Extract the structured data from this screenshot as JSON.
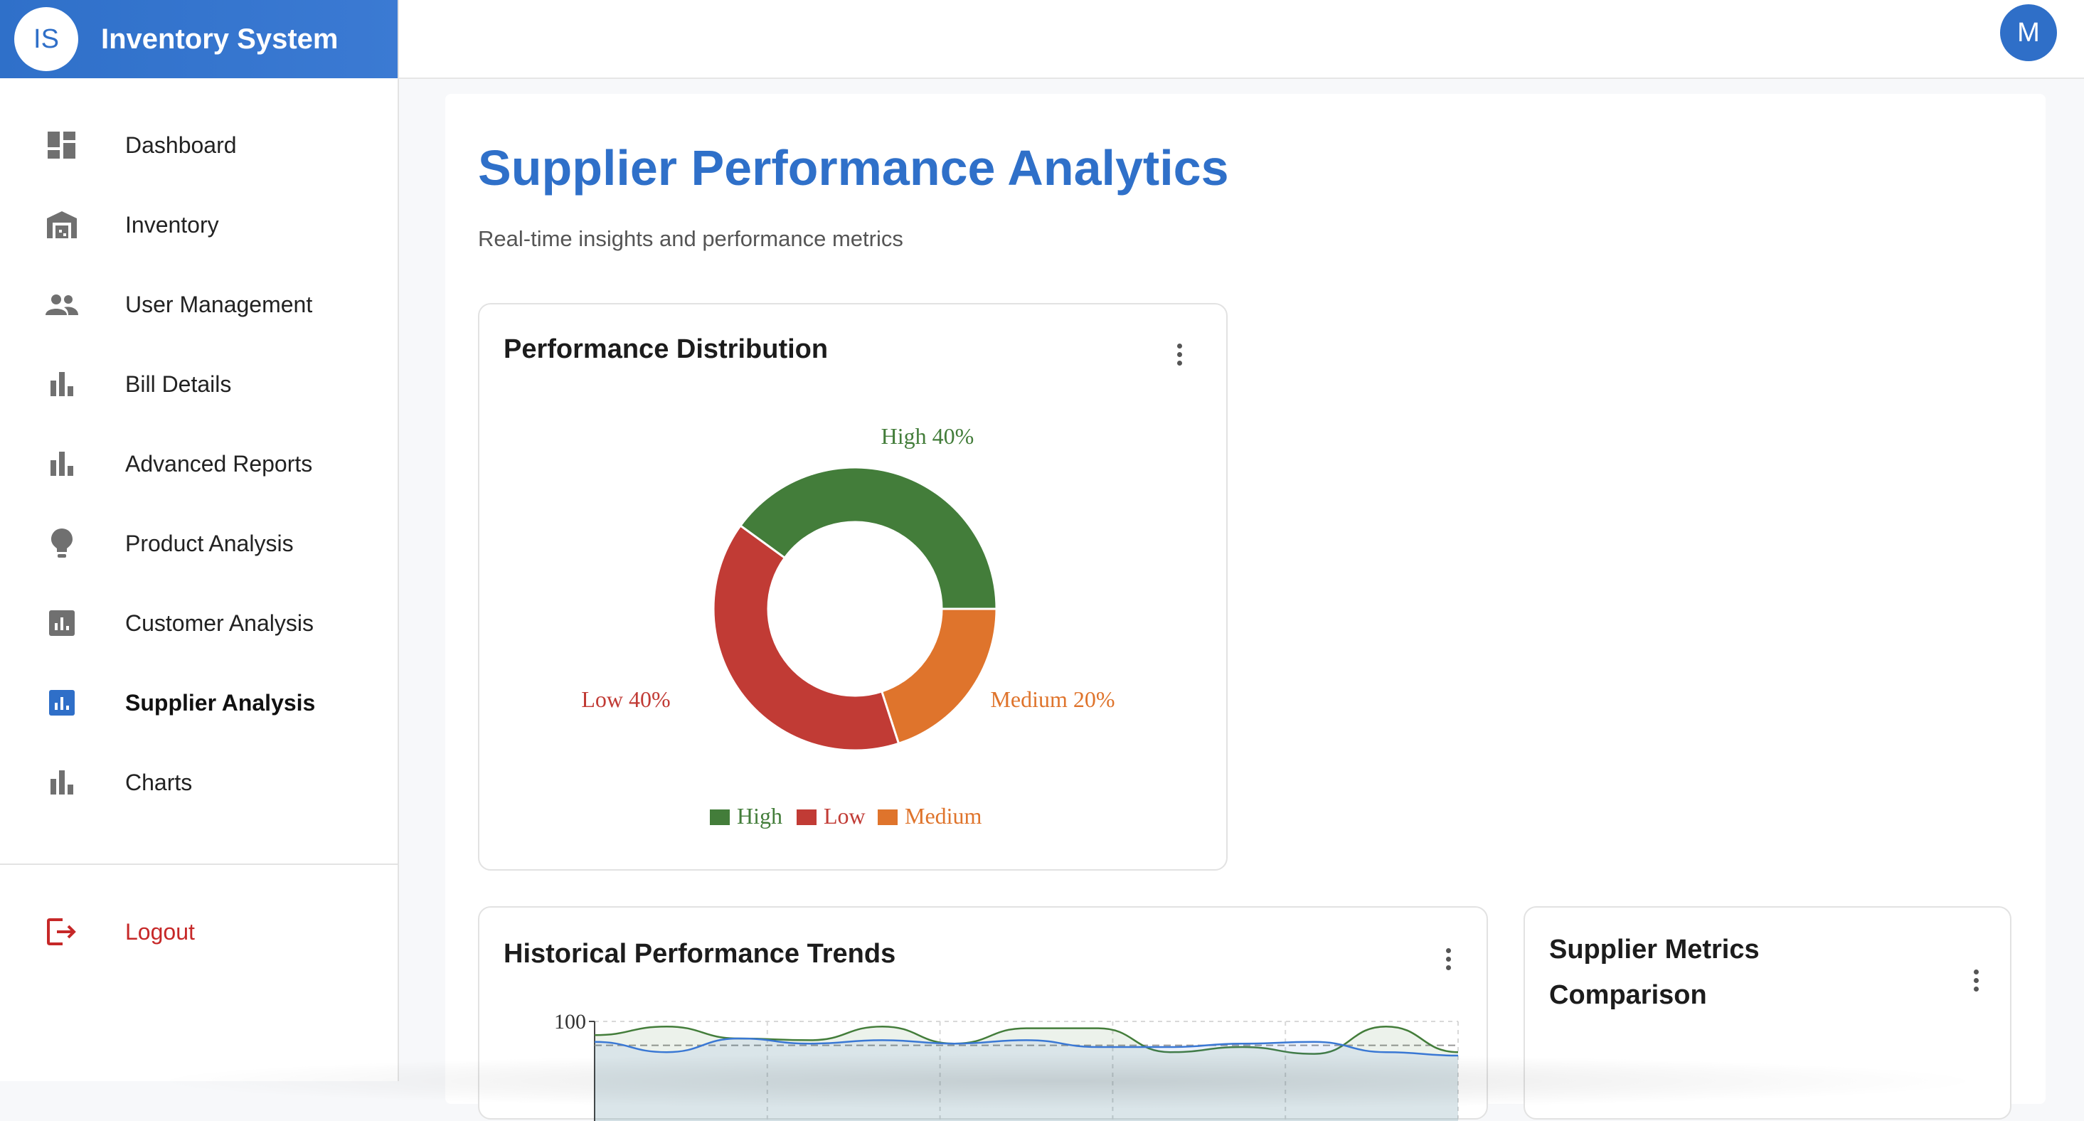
{
  "app": {
    "logo_text": "IS",
    "title": "Inventory System",
    "user_initial": "M"
  },
  "sidebar": {
    "items": [
      {
        "label": "Dashboard",
        "icon": "dashboard-icon"
      },
      {
        "label": "Inventory",
        "icon": "warehouse-icon"
      },
      {
        "label": "User Management",
        "icon": "people-icon"
      },
      {
        "label": "Bill Details",
        "icon": "bar-chart-icon"
      },
      {
        "label": "Advanced Reports",
        "icon": "bar-chart-icon"
      },
      {
        "label": "Product Analysis",
        "icon": "lightbulb-icon"
      },
      {
        "label": "Customer Analysis",
        "icon": "analytics-box-icon"
      },
      {
        "label": "Supplier Analysis",
        "icon": "analytics-box-icon",
        "active": true
      },
      {
        "label": "Charts",
        "icon": "bar-chart-icon"
      }
    ],
    "logout_label": "Logout",
    "active_color": "#2f6fc8",
    "logout_color": "#c62828"
  },
  "page": {
    "title": "Supplier Performance Analytics",
    "subtitle": "Real-time insights and performance metrics"
  },
  "cards": {
    "distribution_title": "Performance Distribution",
    "history_title": "Historical Performance Trends",
    "comparison_title_line1": "Supplier Metrics",
    "comparison_title_line2": "Comparison"
  },
  "chart_data": [
    {
      "type": "pie",
      "donut": true,
      "title": "Performance Distribution",
      "categories": [
        "High",
        "Low",
        "Medium"
      ],
      "values": [
        40,
        40,
        20
      ],
      "slice_labels": [
        "High 40%",
        "Low 40%",
        "Medium 20%"
      ],
      "colors": [
        "#437d3a",
        "#c13b35",
        "#df742c"
      ],
      "legend": [
        "High",
        "Low",
        "Medium"
      ],
      "legend_position": "bottom"
    },
    {
      "type": "area",
      "title": "Historical Performance Trends",
      "yticks": [
        "100"
      ],
      "ylim": [
        0,
        100
      ],
      "series": [
        {
          "values": [
            92,
            97,
            90,
            89,
            97,
            87,
            96,
            96,
            82,
            85,
            81,
            97,
            82
          ],
          "color": "#437d3a"
        },
        {
          "values": [
            88,
            82,
            90,
            87,
            89,
            87,
            89,
            85,
            85,
            87,
            88,
            82,
            80
          ],
          "color": "#3a78d4"
        }
      ],
      "reference_value": 86,
      "grid": true
    }
  ]
}
